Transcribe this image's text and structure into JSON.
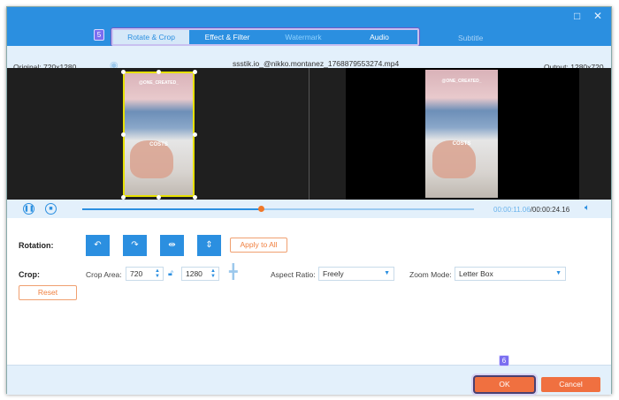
{
  "window": {
    "maximize_icon": "square-icon",
    "close_icon": "x-icon"
  },
  "tabs": [
    {
      "label": "Rotate & Crop",
      "active": true
    },
    {
      "label": "Effect & Filter"
    },
    {
      "label": "Watermark"
    },
    {
      "label": "Audio"
    },
    {
      "label": "Subtitle"
    }
  ],
  "steps": {
    "tabs_badge": "5",
    "ok_badge": "6"
  },
  "info": {
    "original": "Original: 720x1280",
    "filename": "ssstik.io_@nikko.montanez_1768879553274.mp4",
    "output": "Output: 1280x720"
  },
  "video": {
    "overlay_top": "@ONE_CREATED_",
    "overlay_mid": "COSTS"
  },
  "playback": {
    "current": "00:00:11.06",
    "total": "/00:00:24.16",
    "progress_percent": 45.7
  },
  "rotation": {
    "label": "Rotation:",
    "buttons": [
      "rotate-left",
      "rotate-right",
      "flip-horizontal",
      "flip-vertical"
    ],
    "apply_all": "Apply to All"
  },
  "crop": {
    "label": "Crop:",
    "area_label": "Crop Area:",
    "width": "720",
    "height": "1280",
    "aspect_label": "Aspect Ratio:",
    "aspect_value": "Freely",
    "zoom_label": "Zoom Mode:",
    "zoom_value": "Letter Box",
    "reset": "Reset"
  },
  "footer": {
    "ok": "OK",
    "cancel": "Cancel"
  },
  "colors": {
    "accent": "#2b8fe0",
    "orange": "#f07040",
    "step_badge": "#7a6ef0"
  }
}
